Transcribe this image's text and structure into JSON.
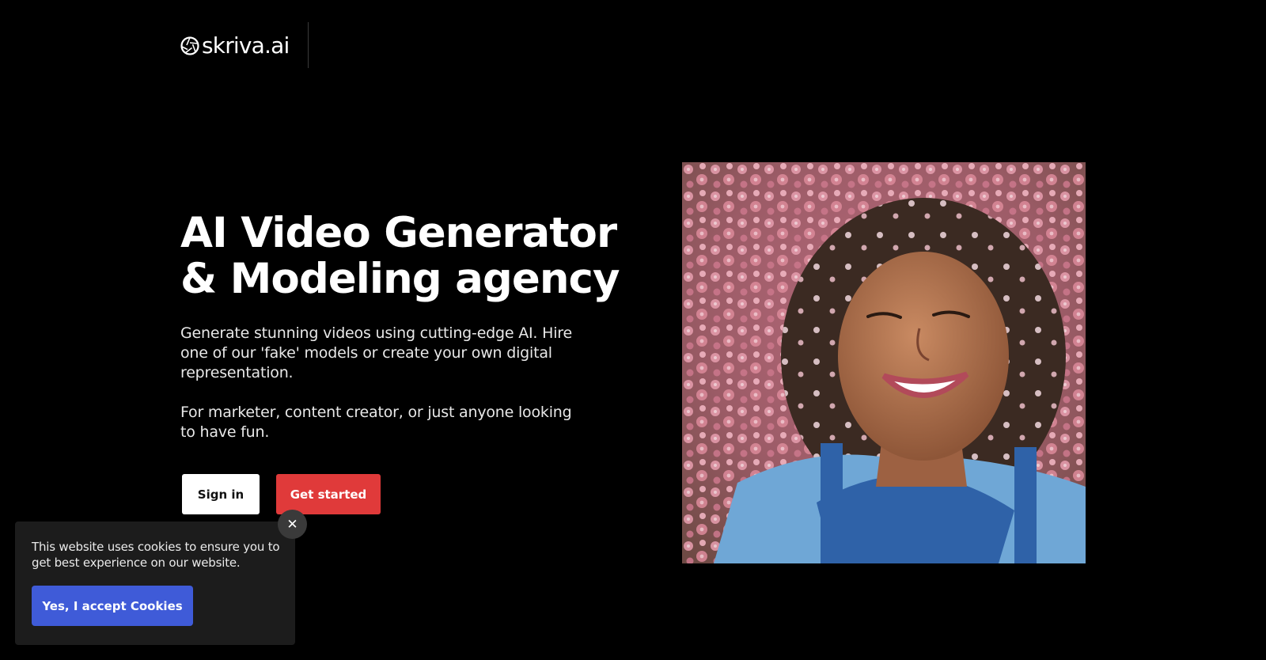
{
  "header": {
    "brand_name": "skriva.ai",
    "logo_icon": "aperture-icon"
  },
  "hero": {
    "title_line1": "AI Video Generator",
    "title_line2": "& Modeling agency",
    "description_1": "Generate stunning videos using cutting-edge AI. Hire one of our 'fake' models or create your own digital representation.",
    "description_2": "For marketer, content creator, or just anyone looking to have fun.",
    "signin_label": "Sign in",
    "get_started_label": "Get started",
    "photo_alt": "Smiling woman lying in pink flowers"
  },
  "cookie_banner": {
    "message": "This website uses cookies to ensure you to get best experience on our website.",
    "accept_label": "Yes, I accept Cookies",
    "close_glyph": "✕"
  },
  "colors": {
    "background": "#000000",
    "primary_red": "#e03a3a",
    "accept_blue": "#3f5bd8"
  }
}
